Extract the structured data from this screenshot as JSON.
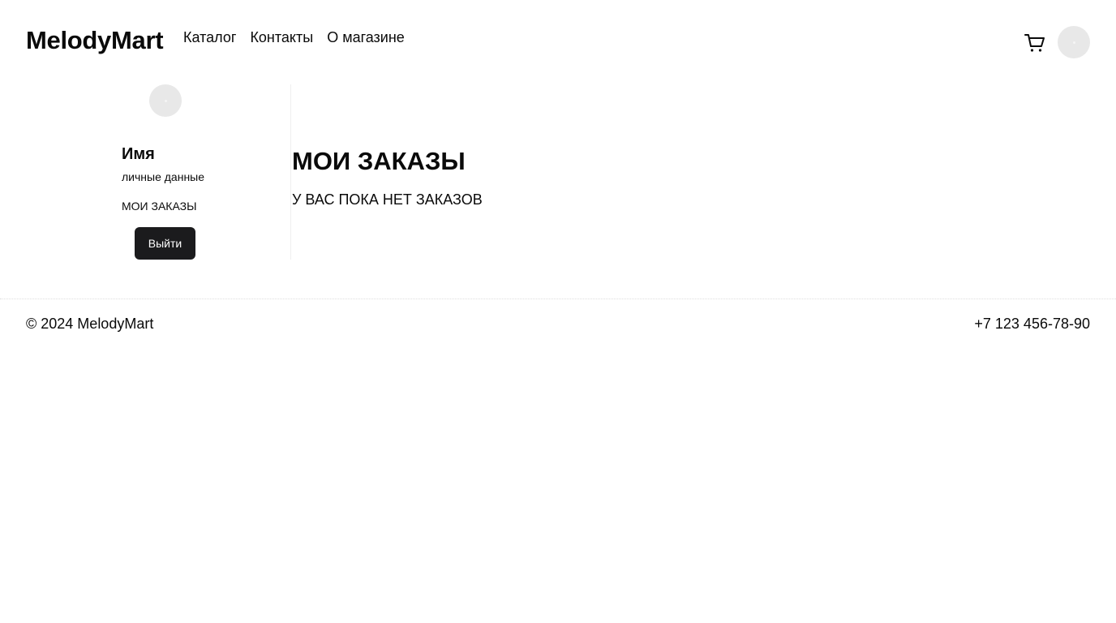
{
  "header": {
    "logo": "MelodyMart",
    "nav": {
      "catalog": "Каталог",
      "contacts": "Контакты",
      "about": "О магазине"
    },
    "cart_icon": "cart-icon"
  },
  "sidebar": {
    "user_name": "Имя",
    "personal_data_link": "личные данные",
    "orders_link": "МОИ ЗАКАЗЫ",
    "logout_label": "Выйти"
  },
  "main": {
    "title": "МОИ ЗАКАЗЫ",
    "empty_message": "У ВАС ПОКА НЕТ ЗАКАЗОВ"
  },
  "footer": {
    "copyright": "© 2024 MelodyMart",
    "phone": "+7 123 456-78-90"
  },
  "colors": {
    "text": "#0a0a0a",
    "button_bg": "#1b1b1d",
    "avatar_bg": "#e8e8e8"
  }
}
